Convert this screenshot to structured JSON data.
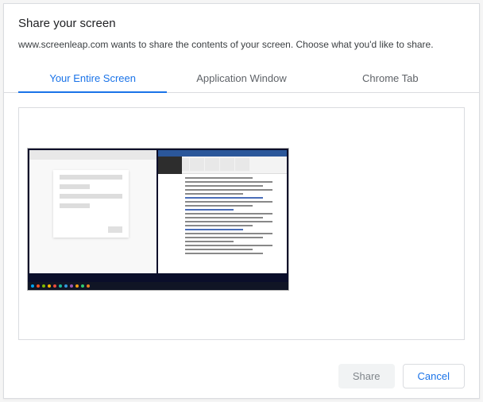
{
  "dialog": {
    "title": "Share your screen",
    "description": "www.screenleap.com wants to share the contents of your screen. Choose what you'd like to share."
  },
  "tabs": [
    {
      "label": "Your Entire Screen",
      "active": true
    },
    {
      "label": "Application Window",
      "active": false
    },
    {
      "label": "Chrome Tab",
      "active": false
    }
  ],
  "buttons": {
    "share": "Share",
    "cancel": "Cancel"
  }
}
